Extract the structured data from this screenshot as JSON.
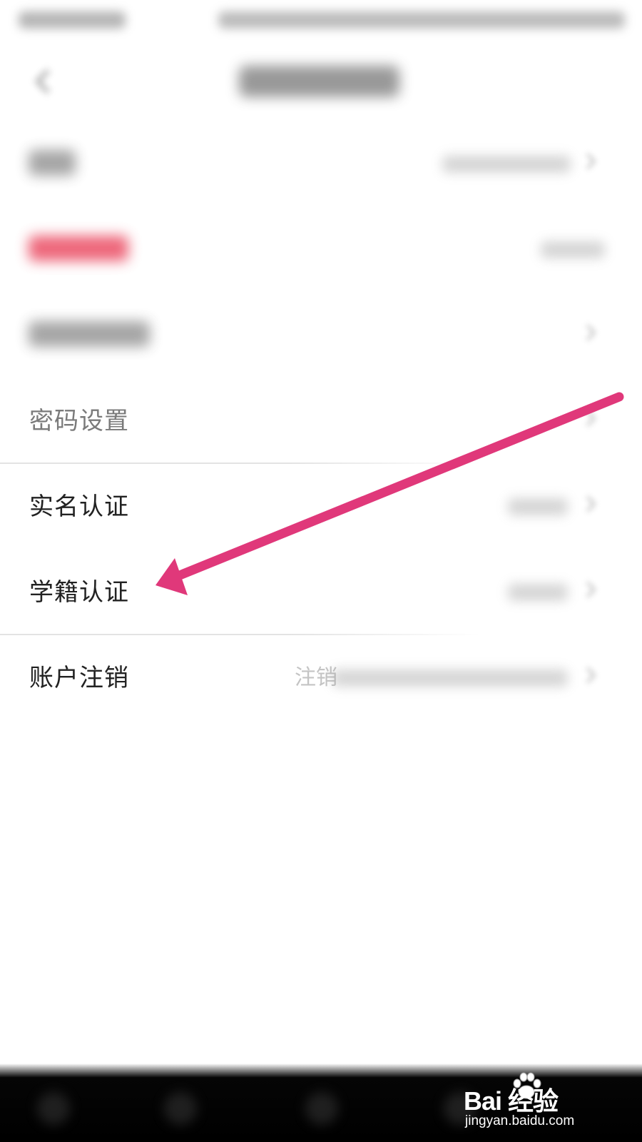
{
  "status_bar": {},
  "header": {},
  "rows": [
    {
      "key": "row-1-blurred"
    },
    {
      "key": "row-2-blurred-red"
    },
    {
      "key": "row-3-blurred"
    },
    {
      "key": "password",
      "label": "密码设置"
    },
    {
      "key": "real-name",
      "label": "实名认证"
    },
    {
      "key": "student",
      "label": "学籍认证"
    },
    {
      "key": "cancel",
      "label": "账户注销",
      "value_visible_text": "注销"
    }
  ],
  "annotation": {
    "type": "arrow",
    "color": "#e0387a",
    "points_to": "学籍认证"
  },
  "watermark": {
    "brand": "Bai 经验",
    "url": "jingyan.baidu.com"
  },
  "colors": {
    "accent_red": "#e8354f",
    "arrow": "#e0387a",
    "nav_bar": "#000000"
  },
  "icons": {
    "back": "chevron-left-icon",
    "row": "chevron-right-icon",
    "watermark": "baidu-paw-icon"
  }
}
